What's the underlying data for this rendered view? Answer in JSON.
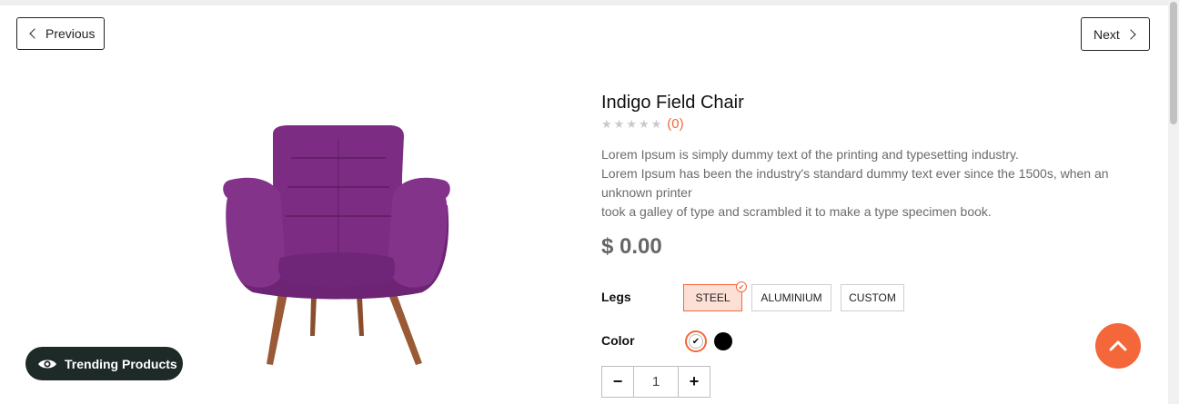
{
  "nav": {
    "previous_label": "Previous",
    "next_label": "Next"
  },
  "product": {
    "title": "Indigo Field Chair",
    "rating_stars": 0,
    "review_count": "(0)",
    "description": [
      "Lorem Ipsum is simply dummy text of the printing and typesetting industry.",
      "Lorem Ipsum has been the industry's standard dummy text ever since the 1500s, when an unknown printer",
      "took a galley of type and scrambled it to make a type specimen book."
    ],
    "price": "$ 0.00",
    "image_alt": "purple upholstered armchair with wooden legs"
  },
  "options": {
    "legs_label": "Legs",
    "legs": [
      {
        "label": "STEEL",
        "selected": true
      },
      {
        "label": "ALUMINIUM",
        "selected": false
      },
      {
        "label": "CUSTOM",
        "selected": false
      }
    ],
    "color_label": "Color",
    "colors": [
      {
        "name": "white",
        "hex": "#ffffff",
        "selected": true
      },
      {
        "name": "black",
        "hex": "#000000",
        "selected": false
      }
    ]
  },
  "quantity": {
    "minus": "−",
    "value": "1",
    "plus": "+"
  },
  "trending": {
    "label": "Trending Products",
    "icon": "eye-icon"
  },
  "scroll_top": {
    "icon": "chevron-up-icon"
  },
  "colors": {
    "accent": "#f4673a",
    "trending_bg": "#1e2a27",
    "chair": "#7a2a80"
  }
}
